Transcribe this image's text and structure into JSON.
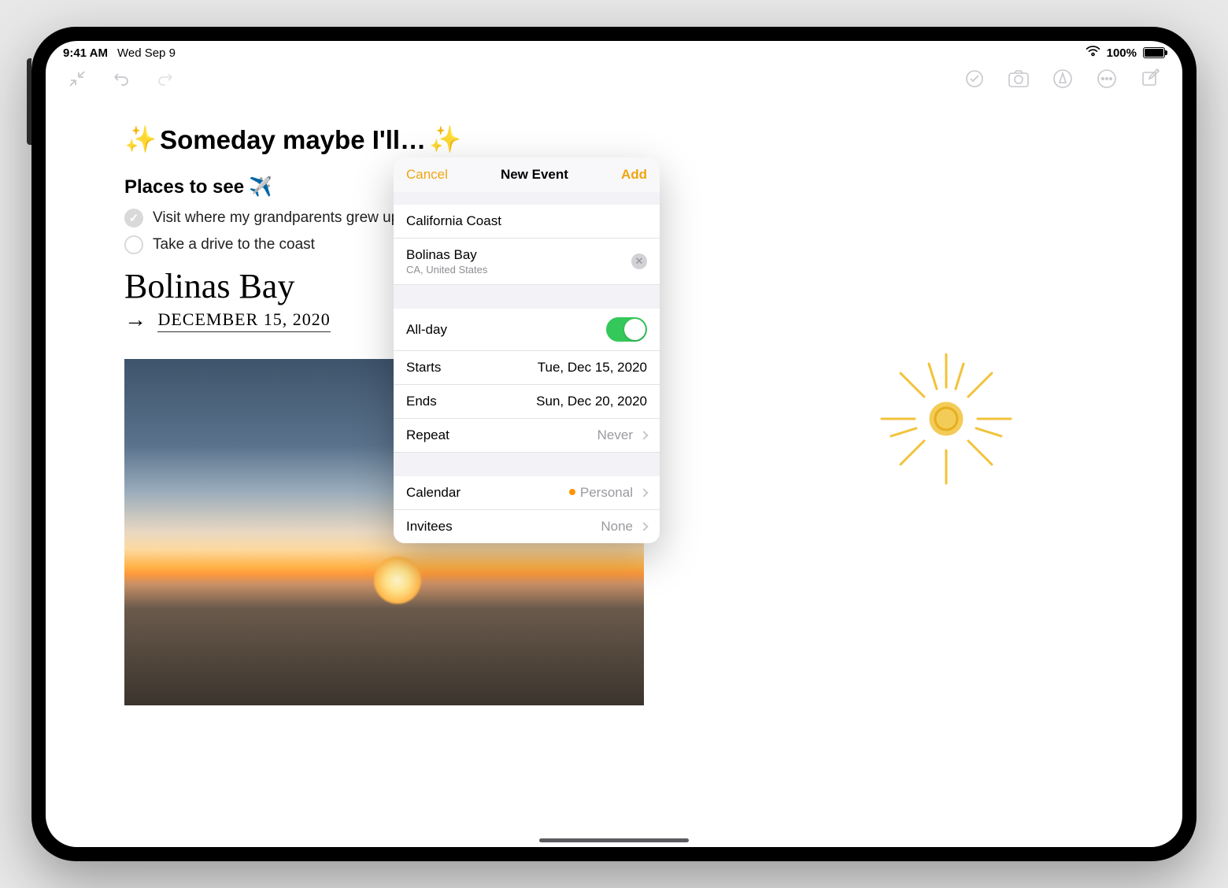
{
  "status": {
    "time": "9:41 AM",
    "date": "Wed Sep 9",
    "battery_pct": "100%"
  },
  "note": {
    "title": "Someday maybe I'll…",
    "section": "Places to see",
    "checklist": [
      {
        "label": "Visit where my grandparents grew up",
        "checked": true
      },
      {
        "label": "Take a drive to the coast",
        "checked": false
      }
    ],
    "handwriting_place": "Bolinas Bay",
    "handwriting_date": "DECEMBER 15, 2020"
  },
  "popover": {
    "cancel": "Cancel",
    "title": "New Event",
    "add": "Add",
    "event_title": "California Coast",
    "location_name": "Bolinas Bay",
    "location_sub": "CA, United States",
    "allday_label": "All-day",
    "allday_on": true,
    "starts_label": "Starts",
    "starts_value": "Tue, Dec 15, 2020",
    "ends_label": "Ends",
    "ends_value": "Sun, Dec 20, 2020",
    "repeat_label": "Repeat",
    "repeat_value": "Never",
    "calendar_label": "Calendar",
    "calendar_value": "Personal",
    "invitees_label": "Invitees",
    "invitees_value": "None"
  }
}
